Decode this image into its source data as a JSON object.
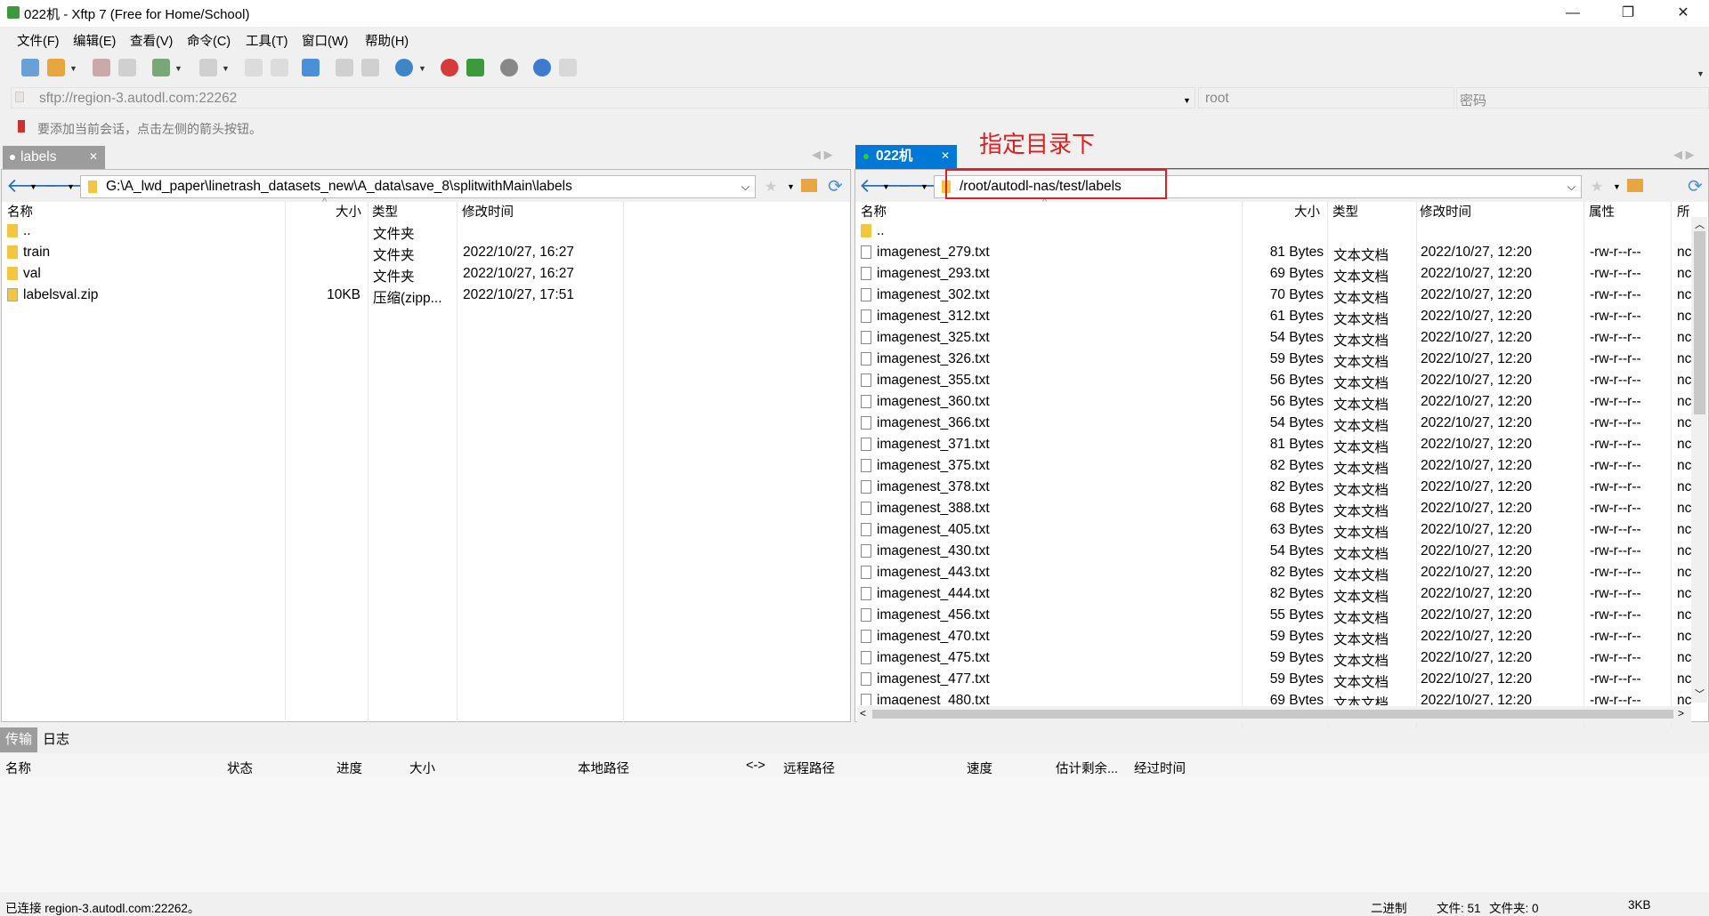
{
  "window": {
    "title": "022机 - Xftp 7 (Free for Home/School)",
    "minimize": "—",
    "maximize": "❐",
    "close": "✕"
  },
  "menu": [
    "文件(F)",
    "编辑(E)",
    "查看(V)",
    "命令(C)",
    "工具(T)",
    "窗口(W)",
    "帮助(H)"
  ],
  "address": {
    "url": "sftp://region-3.autodl.com:22262",
    "user": "root",
    "password_placeholder": "密码"
  },
  "hint": "要添加当前会话，点击左侧的箭头按钮。",
  "annotation": "指定目录下",
  "left_pane": {
    "tab": "labels",
    "path": "G:\\A_lwd_paper\\linetrash_datasets_new\\A_data\\save_8\\splitwithMain\\labels",
    "columns": [
      "名称",
      "大小",
      "类型",
      "修改时间"
    ],
    "rows": [
      {
        "name": "..",
        "size": "",
        "type": "文件夹",
        "time": "",
        "icon": "folder"
      },
      {
        "name": "train",
        "size": "",
        "type": "文件夹",
        "time": "2022/10/27, 16:27",
        "icon": "folder"
      },
      {
        "name": "val",
        "size": "",
        "type": "文件夹",
        "time": "2022/10/27, 16:27",
        "icon": "folder"
      },
      {
        "name": "labelsval.zip",
        "size": "10KB",
        "type": "压缩(zipp...",
        "time": "2022/10/27, 17:51",
        "icon": "zip"
      }
    ]
  },
  "right_pane": {
    "tab": "022机",
    "path": "/root/autodl-nas/test/labels",
    "columns": [
      "名称",
      "大小",
      "类型",
      "修改时间",
      "属性",
      "所"
    ],
    "rows": [
      {
        "name": "..",
        "size": "",
        "type": "",
        "time": "",
        "attr": "",
        "owner": ""
      },
      {
        "name": "imagenest_279.txt",
        "size": "81 Bytes",
        "type": "文本文档",
        "time": "2022/10/27, 12:20",
        "attr": "-rw-r--r--",
        "owner": "nc"
      },
      {
        "name": "imagenest_293.txt",
        "size": "69 Bytes",
        "type": "文本文档",
        "time": "2022/10/27, 12:20",
        "attr": "-rw-r--r--",
        "owner": "nc"
      },
      {
        "name": "imagenest_302.txt",
        "size": "70 Bytes",
        "type": "文本文档",
        "time": "2022/10/27, 12:20",
        "attr": "-rw-r--r--",
        "owner": "nc"
      },
      {
        "name": "imagenest_312.txt",
        "size": "61 Bytes",
        "type": "文本文档",
        "time": "2022/10/27, 12:20",
        "attr": "-rw-r--r--",
        "owner": "nc"
      },
      {
        "name": "imagenest_325.txt",
        "size": "54 Bytes",
        "type": "文本文档",
        "time": "2022/10/27, 12:20",
        "attr": "-rw-r--r--",
        "owner": "nc"
      },
      {
        "name": "imagenest_326.txt",
        "size": "59 Bytes",
        "type": "文本文档",
        "time": "2022/10/27, 12:20",
        "attr": "-rw-r--r--",
        "owner": "nc"
      },
      {
        "name": "imagenest_355.txt",
        "size": "56 Bytes",
        "type": "文本文档",
        "time": "2022/10/27, 12:20",
        "attr": "-rw-r--r--",
        "owner": "nc"
      },
      {
        "name": "imagenest_360.txt",
        "size": "56 Bytes",
        "type": "文本文档",
        "time": "2022/10/27, 12:20",
        "attr": "-rw-r--r--",
        "owner": "nc"
      },
      {
        "name": "imagenest_366.txt",
        "size": "54 Bytes",
        "type": "文本文档",
        "time": "2022/10/27, 12:20",
        "attr": "-rw-r--r--",
        "owner": "nc"
      },
      {
        "name": "imagenest_371.txt",
        "size": "81 Bytes",
        "type": "文本文档",
        "time": "2022/10/27, 12:20",
        "attr": "-rw-r--r--",
        "owner": "nc"
      },
      {
        "name": "imagenest_375.txt",
        "size": "82 Bytes",
        "type": "文本文档",
        "time": "2022/10/27, 12:20",
        "attr": "-rw-r--r--",
        "owner": "nc"
      },
      {
        "name": "imagenest_378.txt",
        "size": "82 Bytes",
        "type": "文本文档",
        "time": "2022/10/27, 12:20",
        "attr": "-rw-r--r--",
        "owner": "nc"
      },
      {
        "name": "imagenest_388.txt",
        "size": "68 Bytes",
        "type": "文本文档",
        "time": "2022/10/27, 12:20",
        "attr": "-rw-r--r--",
        "owner": "nc"
      },
      {
        "name": "imagenest_405.txt",
        "size": "63 Bytes",
        "type": "文本文档",
        "time": "2022/10/27, 12:20",
        "attr": "-rw-r--r--",
        "owner": "nc"
      },
      {
        "name": "imagenest_430.txt",
        "size": "54 Bytes",
        "type": "文本文档",
        "time": "2022/10/27, 12:20",
        "attr": "-rw-r--r--",
        "owner": "nc"
      },
      {
        "name": "imagenest_443.txt",
        "size": "82 Bytes",
        "type": "文本文档",
        "time": "2022/10/27, 12:20",
        "attr": "-rw-r--r--",
        "owner": "nc"
      },
      {
        "name": "imagenest_444.txt",
        "size": "82 Bytes",
        "type": "文本文档",
        "time": "2022/10/27, 12:20",
        "attr": "-rw-r--r--",
        "owner": "nc"
      },
      {
        "name": "imagenest_456.txt",
        "size": "55 Bytes",
        "type": "文本文档",
        "time": "2022/10/27, 12:20",
        "attr": "-rw-r--r--",
        "owner": "nc"
      },
      {
        "name": "imagenest_470.txt",
        "size": "59 Bytes",
        "type": "文本文档",
        "time": "2022/10/27, 12:20",
        "attr": "-rw-r--r--",
        "owner": "nc"
      },
      {
        "name": "imagenest_475.txt",
        "size": "59 Bytes",
        "type": "文本文档",
        "time": "2022/10/27, 12:20",
        "attr": "-rw-r--r--",
        "owner": "nc"
      },
      {
        "name": "imagenest_477.txt",
        "size": "59 Bytes",
        "type": "文本文档",
        "time": "2022/10/27, 12:20",
        "attr": "-rw-r--r--",
        "owner": "nc"
      },
      {
        "name": "imagenest_480.txt",
        "size": "69 Bytes",
        "type": "文本文档",
        "time": "2022/10/27, 12:20",
        "attr": "-rw-r--r--",
        "owner": "nc"
      }
    ]
  },
  "bottom_tabs": [
    "传输",
    "日志"
  ],
  "transfer_columns": [
    "名称",
    "状态",
    "进度",
    "大小",
    "本地路径",
    "<->",
    "远程路径",
    "速度",
    "估计剩余...",
    "经过时间"
  ],
  "status": {
    "connection": "已连接 region-3.autodl.com:22262。",
    "mode": "二进制",
    "files": "文件: 51",
    "folders": "文件夹: 0",
    "size": "3KB"
  }
}
